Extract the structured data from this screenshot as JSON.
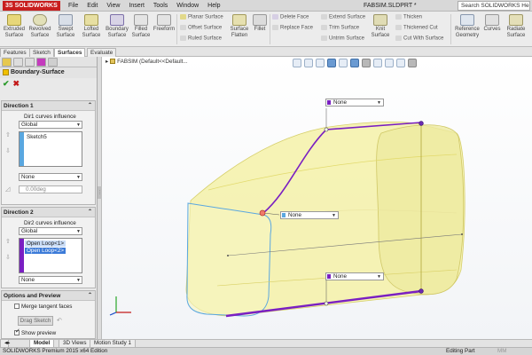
{
  "app": {
    "logo_text": "SOLIDWORKS",
    "window_title": "FABSIM.SLDPRT *",
    "search_placeholder": "Search SOLIDWORKS Help"
  },
  "menu": [
    "File",
    "Edit",
    "View",
    "Insert",
    "Tools",
    "Window",
    "Help"
  ],
  "ribbon": {
    "big_buttons": [
      {
        "label": "Extruded Surface",
        "icon": "extruded-surface-icon"
      },
      {
        "label": "Revolved Surface",
        "icon": "revolved-surface-icon"
      },
      {
        "label": "Swept Surface",
        "icon": "swept-surface-icon"
      },
      {
        "label": "Lofted Surface",
        "icon": "lofted-surface-icon"
      },
      {
        "label": "Boundary Surface",
        "icon": "boundary-surface-icon"
      },
      {
        "label": "Filled Surface",
        "icon": "filled-surface-icon"
      },
      {
        "label": "Freeform",
        "icon": "freeform-icon"
      }
    ],
    "small_col1": [
      "Planar Surface",
      "Offset Surface",
      "Ruled Surface"
    ],
    "flatten": "Surface Flatten",
    "fillet": "Fillet",
    "small_col2": [
      "Delete Face",
      "Replace Face"
    ],
    "small_col3": [
      "Extend Surface",
      "Trim Surface",
      "Untrim Surface"
    ],
    "knit": "Knit Surface",
    "small_col4": [
      "Thicken",
      "Thickened Cut",
      "Cut With Surface"
    ],
    "right_buttons": [
      "Reference Geometry",
      "Curves",
      "Radiate Surface"
    ]
  },
  "cm_tabs": [
    "Features",
    "Sketch",
    "Surfaces",
    "Evaluate"
  ],
  "cm_active": "Surfaces",
  "property_manager": {
    "title": "Boundary-Surface",
    "direction1": {
      "title": "Direction 1",
      "influence_label": "Dir1 curves influence",
      "influence_value": "Global",
      "items": [
        "Sketch5"
      ],
      "tangency": "None",
      "angle": "0.00deg"
    },
    "direction2": {
      "title": "Direction 2",
      "influence_label": "Dir2 curves influence",
      "influence_value": "Global",
      "items": [
        "Open Loop<1>",
        "Open Loop<2>"
      ],
      "tangency": "None"
    },
    "options": {
      "title": "Options and Preview",
      "merge_tangent": "Merge tangent faces",
      "drag_sketch": "Drag Sketch",
      "show_preview": "Show preview"
    }
  },
  "viewport": {
    "tree_root": "FABSIM",
    "tree_config": "(Default<<Default..."
  },
  "callouts": [
    "None",
    "None",
    "None"
  ],
  "bottom_tabs": [
    "Model",
    "3D Views",
    "Motion Study 1"
  ],
  "status": {
    "left": "SOLIDWORKS Premium 2015 x64 Edition",
    "right": "Editing Part",
    "units": "MM"
  },
  "colors": {
    "surface_fill": "#f4f1a8",
    "curve_purple": "#7a1fc2",
    "curve_blue": "#5aa7e0",
    "accent_red": "#c81e1e"
  }
}
